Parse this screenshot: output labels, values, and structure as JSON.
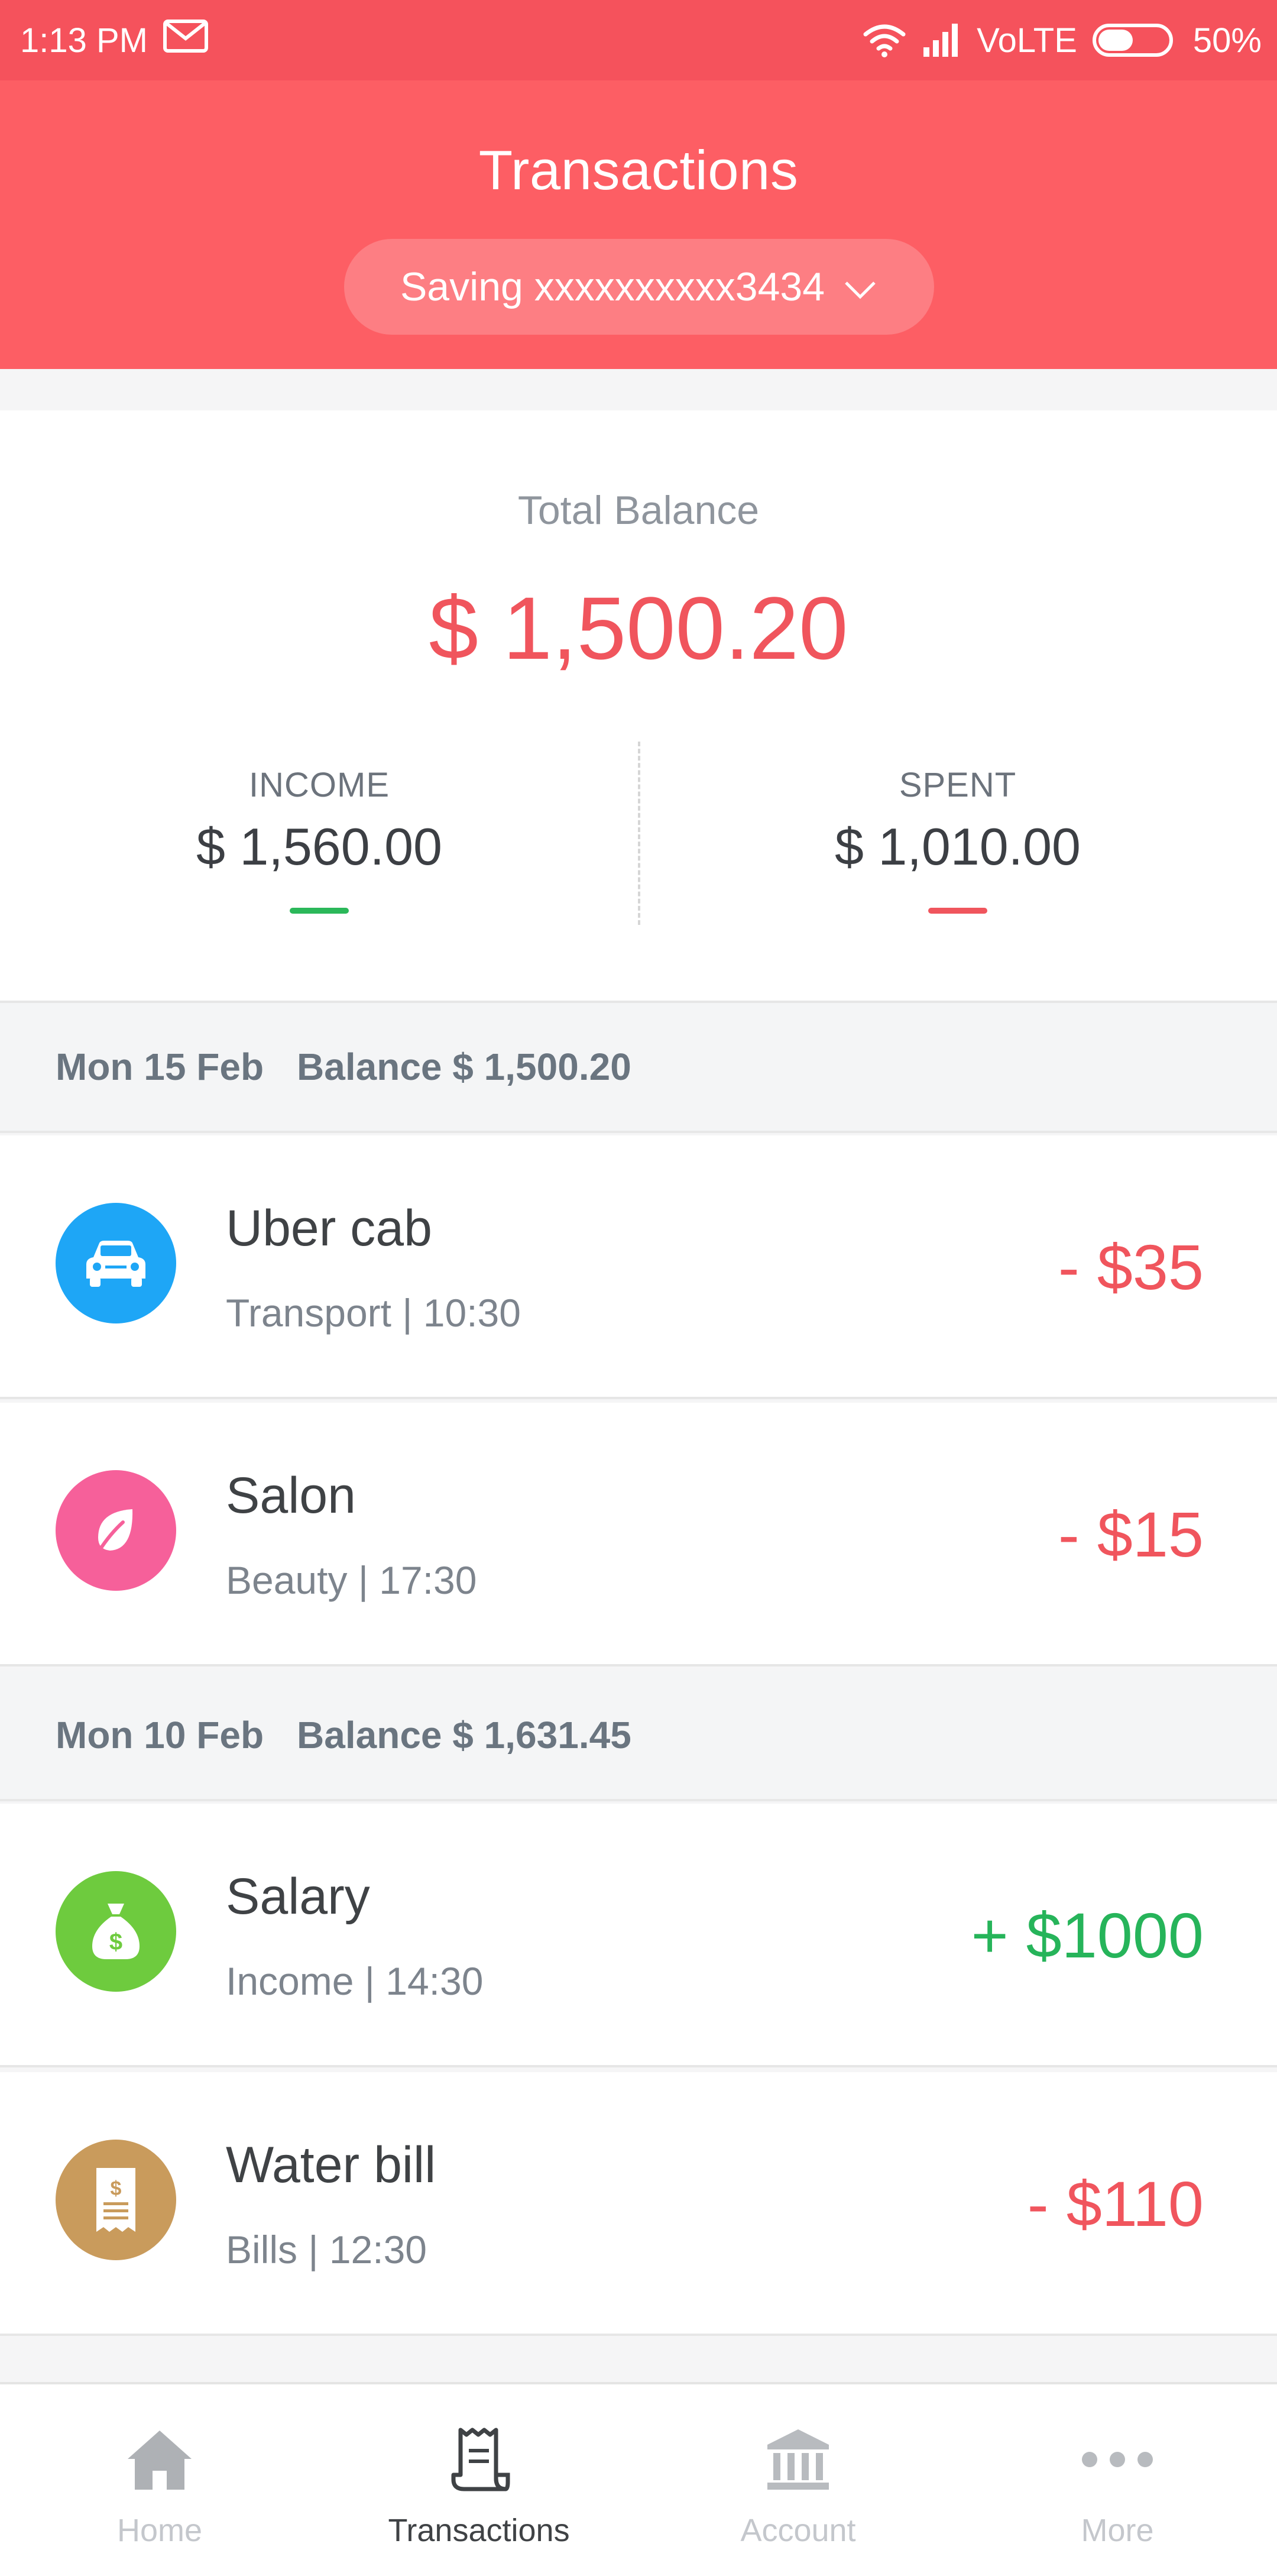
{
  "status_bar": {
    "time": "1:13 PM",
    "network": "VoLTE",
    "battery": "50%"
  },
  "header": {
    "title": "Transactions",
    "account_selector": "Saving xxxxxxxxxx3434"
  },
  "summary": {
    "total_label": "Total Balance",
    "total_value": "$ 1,500.20",
    "income_label": "INCOME",
    "income_value": "$ 1,560.00",
    "spent_label": "SPENT",
    "spent_value": "$ 1,010.00",
    "income_color": "#2bb85a",
    "spent_color": "#f0555d"
  },
  "days": [
    {
      "date": "Mon 15 Feb",
      "balance": "Balance $ 1,500.20",
      "transactions": [
        {
          "name": "Uber cab",
          "meta": "Transport | 10:30",
          "amount": "- $35",
          "icon": "car-icon",
          "icon_color": "#1ea6f6",
          "amount_color": "#f0555d"
        },
        {
          "name": "Salon",
          "meta": "Beauty | 17:30",
          "amount": "- $15",
          "icon": "leaf-icon",
          "icon_color": "#f6609a",
          "amount_color": "#f0555d"
        }
      ]
    },
    {
      "date": "Mon 10 Feb",
      "balance": "Balance $ 1,631.45",
      "transactions": [
        {
          "name": "Salary",
          "meta": "Income | 14:30",
          "amount": "+ $1000",
          "icon": "money-bag-icon",
          "icon_color": "#6ecb3e",
          "amount_color": "#26b45a"
        },
        {
          "name": "Water bill",
          "meta": "Bills | 12:30",
          "amount": "- $110",
          "icon": "receipt-icon",
          "icon_color": "#c99b5c",
          "amount_color": "#f0555d"
        }
      ]
    }
  ],
  "bottom_nav": {
    "items": [
      {
        "label": "Home",
        "icon": "home-icon",
        "active": false
      },
      {
        "label": "Transactions",
        "icon": "transactions-icon",
        "active": true
      },
      {
        "label": "Account",
        "icon": "bank-icon",
        "active": false
      },
      {
        "label": "More",
        "icon": "more-icon",
        "active": false
      }
    ],
    "active_color": "#3f4245",
    "inactive_color": "#c4c7cc"
  }
}
